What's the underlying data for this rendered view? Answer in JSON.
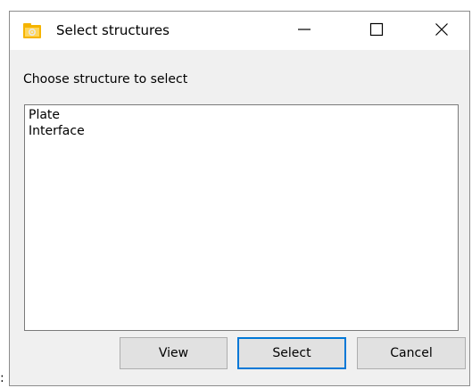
{
  "window": {
    "title": "Select structures",
    "app_icon": "folder-gear-icon",
    "controls": {
      "minimize_icon": "minimize-icon",
      "maximize_icon": "maximize-icon",
      "close_icon": "close-icon"
    }
  },
  "dialog": {
    "prompt": "Choose structure to select",
    "items": [
      "Plate",
      "Interface"
    ],
    "buttons": {
      "view": "View",
      "select": "Select",
      "cancel": "Cancel"
    }
  },
  "colors": {
    "focus_border": "#0078d7",
    "button_face": "#e1e1e1",
    "dialog_bg": "#f0f0f0"
  },
  "stray_text": ":"
}
